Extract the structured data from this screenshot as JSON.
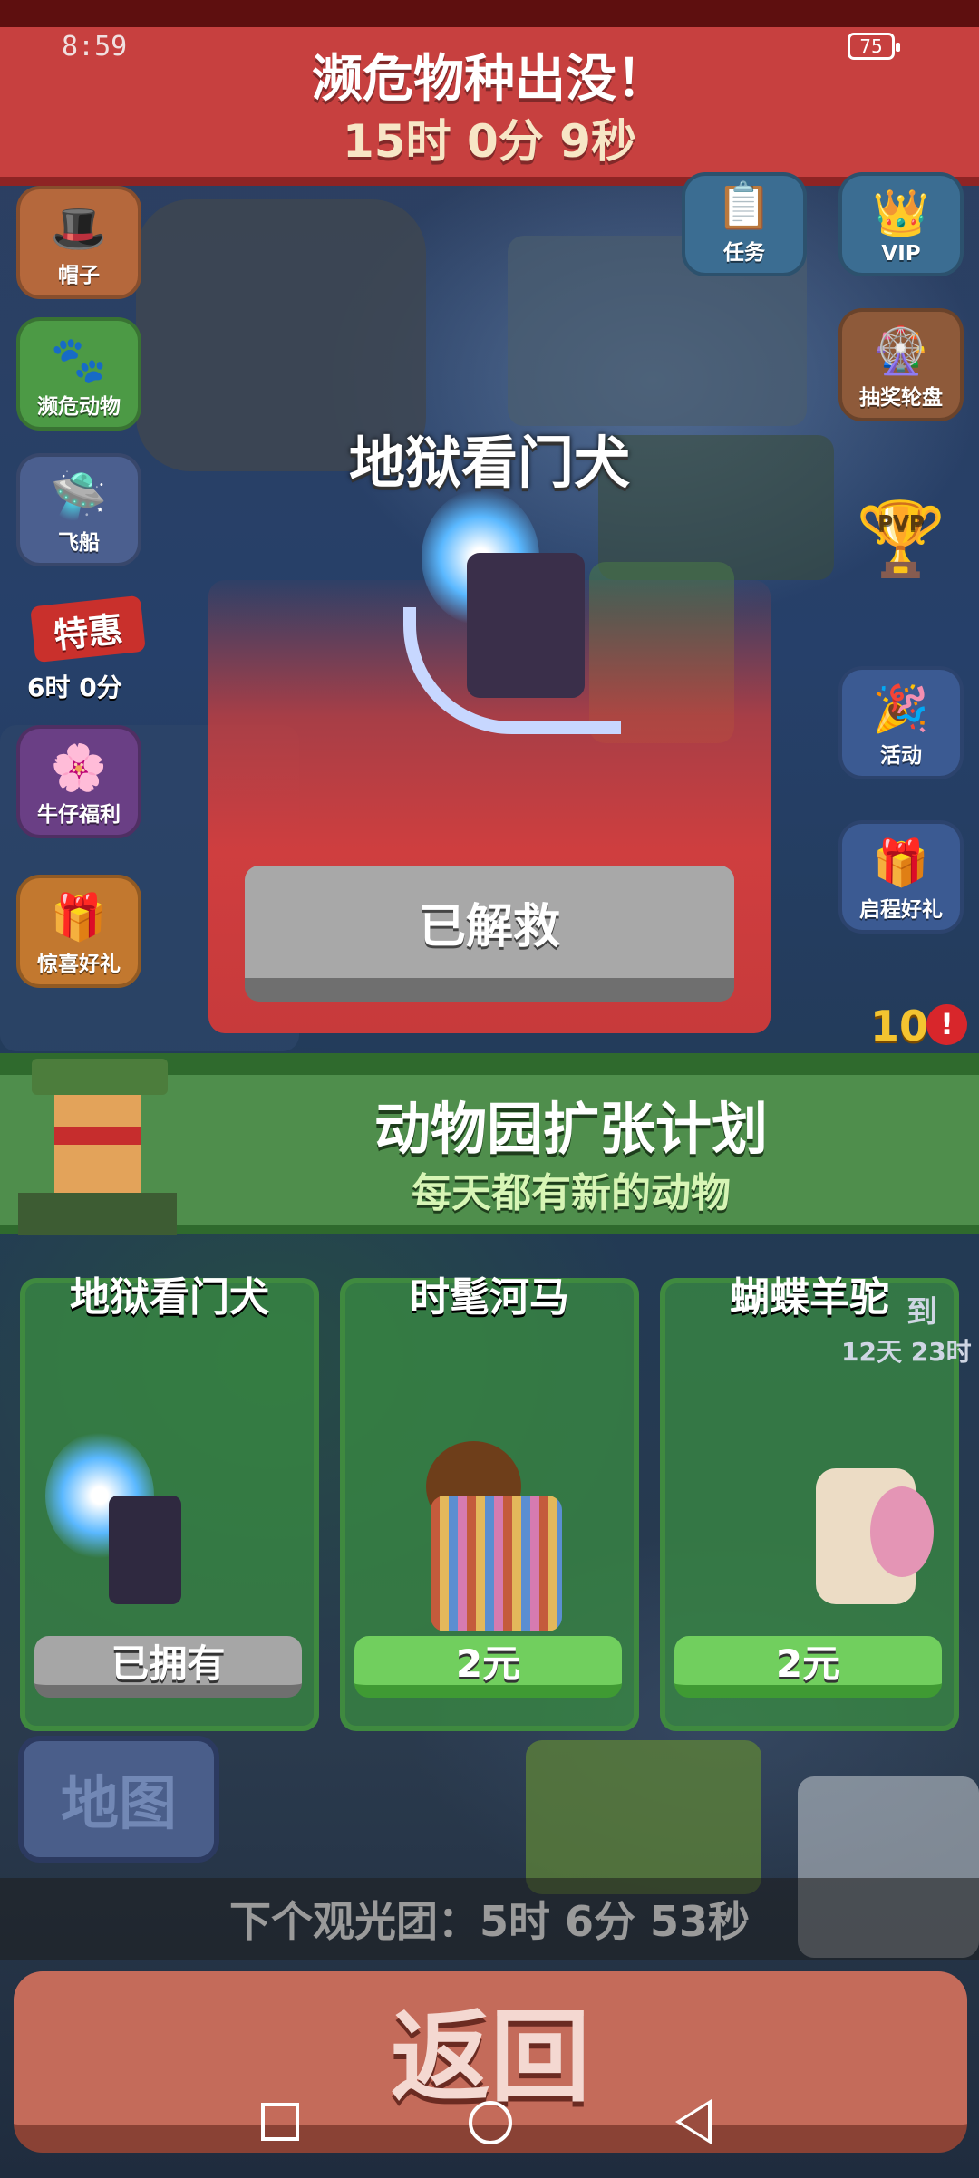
{
  "status": {
    "time": "8:59",
    "battery": "75"
  },
  "banner": {
    "title": "濒危物种出没！",
    "countdown": "15时 0分 9秒"
  },
  "left_menu": [
    {
      "label": "帽子",
      "icon": "hat-icon"
    },
    {
      "label": "濒危动物",
      "icon": "paw-icon"
    },
    {
      "label": "飞船",
      "icon": "airship-icon"
    },
    {
      "label": "特惠",
      "sublabel": "6时 0分",
      "icon": "sale-tag-icon"
    },
    {
      "label": "牛仔福利",
      "icon": "flower-icon"
    },
    {
      "label": "惊喜好礼",
      "icon": "gift-icon"
    }
  ],
  "right_menu": [
    {
      "label": "任务",
      "icon": "task-icon"
    },
    {
      "label": "VIP",
      "icon": "vip-icon"
    },
    {
      "label": "抽奖轮盘",
      "icon": "roulette-icon"
    },
    {
      "label": "PVP",
      "icon": "trophy-icon"
    },
    {
      "label": "活动",
      "icon": "event-icon"
    },
    {
      "label": "启程好礼",
      "icon": "gift-stack-icon"
    }
  ],
  "notification": {
    "count": "10",
    "alert": "!"
  },
  "rescue": {
    "animal_name": "地狱看门犬",
    "button_label": "已解救"
  },
  "expansion": {
    "title": "动物园扩张计划",
    "subtitle": "每天都有新的动物"
  },
  "animals": [
    {
      "name": "地狱看门犬",
      "action": "已拥有",
      "owned": true
    },
    {
      "name": "时髦河马",
      "action": "2元",
      "owned": false
    },
    {
      "name": "蝴蝶羊驼",
      "action": "2元",
      "owned": false
    }
  ],
  "side_hint": {
    "timer": "12天 23时",
    "label": "到"
  },
  "map_button": "地图",
  "tour": {
    "text": "下个观光团：5时 6分 53秒"
  },
  "back_button": "返回",
  "colors": {
    "banner": "#c7403f",
    "green_header": "#4f8e4c",
    "back": "#c46b5a"
  }
}
